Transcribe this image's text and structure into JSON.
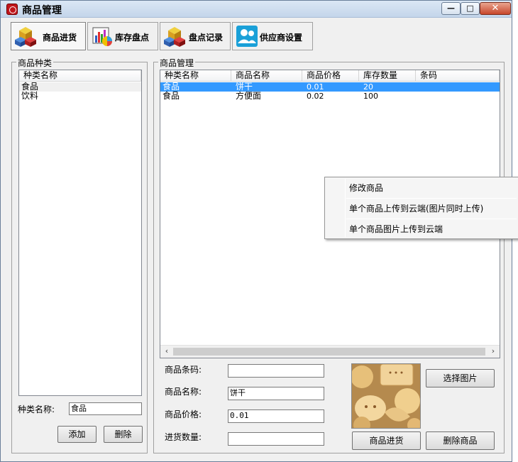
{
  "window": {
    "title": "商品管理"
  },
  "toolbar": {
    "tabs": [
      {
        "label": "商品进货",
        "icon": "cubes-icon"
      },
      {
        "label": "库存盘点",
        "icon": "chart-icon"
      },
      {
        "label": "盘点记录",
        "icon": "cubes-icon"
      },
      {
        "label": "供应商设置",
        "icon": "users-icon"
      }
    ]
  },
  "category_panel": {
    "title": "商品种类",
    "header": "种类名称",
    "items": [
      "食品",
      "饮料"
    ],
    "name_label": "种类名称:",
    "name_value": "食品",
    "add_label": "添加",
    "delete_label": "删除"
  },
  "product_panel": {
    "title": "商品管理",
    "columns": [
      "种类名称",
      "商品名称",
      "商品价格",
      "库存数量",
      "条码"
    ],
    "rows": [
      [
        "食品",
        "饼干",
        "0.01",
        "20",
        ""
      ],
      [
        "食品",
        "方便面",
        "0.02",
        "100",
        ""
      ]
    ]
  },
  "form": {
    "barcode_label": "商品条码:",
    "barcode_value": "",
    "name_label": "商品名称:",
    "name_value": "饼干",
    "price_label": "商品价格:",
    "price_value": "0.01",
    "qty_label": "进货数量:",
    "qty_value": "",
    "select_image_label": "选择图片",
    "stock_in_label": "商品进货",
    "delete_product_label": "删除商品"
  },
  "context_menu": {
    "items": [
      "修改商品",
      "单个商品上传到云端(图片同时上传)",
      "单个商品图片上传到云端"
    ]
  },
  "colors": {
    "selection": "#3399ff",
    "title_bar": "#c4d5ea",
    "close_button": "#c7462b"
  }
}
